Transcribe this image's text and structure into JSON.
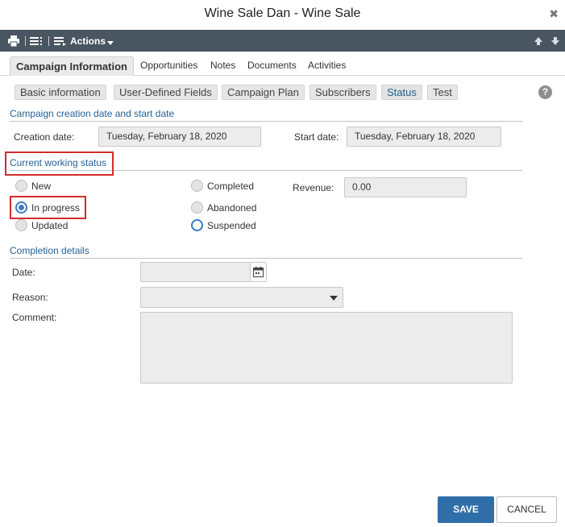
{
  "window": {
    "title": "Wine Sale Dan - Wine Sale",
    "close_glyph": "✖"
  },
  "toolbar": {
    "actions_label": "Actions",
    "icons": [
      "printer-icon",
      "list-menu-icon",
      "actions-list-icon",
      "arrow-up-icon",
      "arrow-down-icon"
    ]
  },
  "tabs": [
    "Campaign Information",
    "Opportunities",
    "Notes",
    "Documents",
    "Activities"
  ],
  "subtabs": [
    "Basic information",
    "User-Defined Fields",
    "Campaign Plan",
    "Subscribers",
    "Status",
    "Test"
  ],
  "help_glyph": "?",
  "creation_section": {
    "heading": "Campaign creation date and start date",
    "creation_label": "Creation date:",
    "creation_value": "Tuesday, February 18, 2020",
    "start_label": "Start date:",
    "start_value": "Tuesday, February 18, 2020"
  },
  "status_section": {
    "heading": "Current working status",
    "options": [
      "New",
      "In progress",
      "Updated",
      "Completed",
      "Abandoned",
      "Suspended"
    ],
    "selected": "In progress",
    "revenue_label": "Revenue:",
    "revenue_value": "0.00"
  },
  "completion_section": {
    "heading": "Completion details",
    "date_label": "Date:",
    "reason_label": "Reason:",
    "comment_label": "Comment:"
  },
  "buttons": {
    "save": "SAVE",
    "cancel": "CANCEL"
  },
  "colors": {
    "accent": "#2f6ea8",
    "toolbar": "#4a5562",
    "heading": "#22629a",
    "highlight": "#d52b2b"
  }
}
